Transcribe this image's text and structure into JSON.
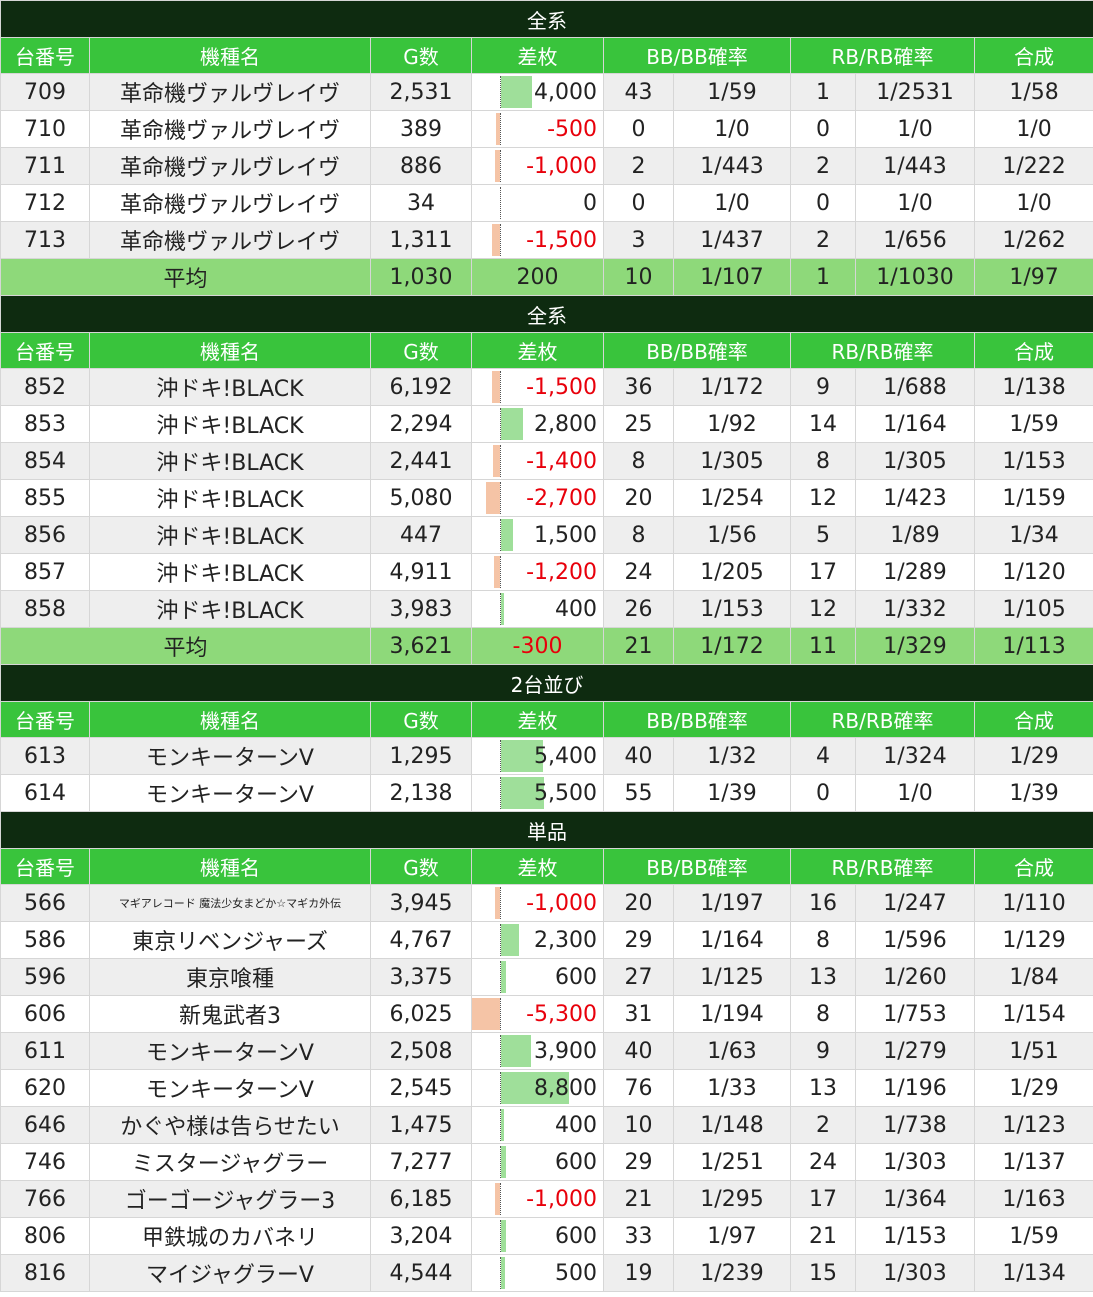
{
  "columns": [
    "台番号",
    "機種名",
    "G数",
    "差枚",
    "BB/BB確率",
    "RB/RB確率",
    "合成"
  ],
  "diff_scale_max": 8800,
  "sections": [
    {
      "title": "全系",
      "rows": [
        {
          "no": "709",
          "name": "革命機ヴァルヴレイヴ",
          "g": "2,531",
          "diff": "4,000",
          "diff_value": 4000,
          "bb": "43",
          "bb_prob": "1/59",
          "rb": "1",
          "rb_prob": "1/2531",
          "total": "1/58"
        },
        {
          "no": "710",
          "name": "革命機ヴァルヴレイヴ",
          "g": "389",
          "diff": "-500",
          "diff_value": -500,
          "bb": "0",
          "bb_prob": "1/0",
          "rb": "0",
          "rb_prob": "1/0",
          "total": "1/0"
        },
        {
          "no": "711",
          "name": "革命機ヴァルヴレイヴ",
          "g": "886",
          "diff": "-1,000",
          "diff_value": -1000,
          "bb": "2",
          "bb_prob": "1/443",
          "rb": "2",
          "rb_prob": "1/443",
          "total": "1/222"
        },
        {
          "no": "712",
          "name": "革命機ヴァルヴレイヴ",
          "g": "34",
          "diff": "0",
          "diff_value": 0,
          "bb": "0",
          "bb_prob": "1/0",
          "rb": "0",
          "rb_prob": "1/0",
          "total": "1/0"
        },
        {
          "no": "713",
          "name": "革命機ヴァルヴレイヴ",
          "g": "1,311",
          "diff": "-1,500",
          "diff_value": -1500,
          "bb": "3",
          "bb_prob": "1/437",
          "rb": "2",
          "rb_prob": "1/656",
          "total": "1/262"
        }
      ],
      "average": {
        "label": "平均",
        "g": "1,030",
        "diff": "200",
        "diff_value": 200,
        "bb": "10",
        "bb_prob": "1/107",
        "rb": "1",
        "rb_prob": "1/1030",
        "total": "1/97"
      }
    },
    {
      "title": "全系",
      "rows": [
        {
          "no": "852",
          "name": "沖ドキ!BLACK",
          "g": "6,192",
          "diff": "-1,500",
          "diff_value": -1500,
          "bb": "36",
          "bb_prob": "1/172",
          "rb": "9",
          "rb_prob": "1/688",
          "total": "1/138"
        },
        {
          "no": "853",
          "name": "沖ドキ!BLACK",
          "g": "2,294",
          "diff": "2,800",
          "diff_value": 2800,
          "bb": "25",
          "bb_prob": "1/92",
          "rb": "14",
          "rb_prob": "1/164",
          "total": "1/59"
        },
        {
          "no": "854",
          "name": "沖ドキ!BLACK",
          "g": "2,441",
          "diff": "-1,400",
          "diff_value": -1400,
          "bb": "8",
          "bb_prob": "1/305",
          "rb": "8",
          "rb_prob": "1/305",
          "total": "1/153"
        },
        {
          "no": "855",
          "name": "沖ドキ!BLACK",
          "g": "5,080",
          "diff": "-2,700",
          "diff_value": -2700,
          "bb": "20",
          "bb_prob": "1/254",
          "rb": "12",
          "rb_prob": "1/423",
          "total": "1/159"
        },
        {
          "no": "856",
          "name": "沖ドキ!BLACK",
          "g": "447",
          "diff": "1,500",
          "diff_value": 1500,
          "bb": "8",
          "bb_prob": "1/56",
          "rb": "5",
          "rb_prob": "1/89",
          "total": "1/34"
        },
        {
          "no": "857",
          "name": "沖ドキ!BLACK",
          "g": "4,911",
          "diff": "-1,200",
          "diff_value": -1200,
          "bb": "24",
          "bb_prob": "1/205",
          "rb": "17",
          "rb_prob": "1/289",
          "total": "1/120"
        },
        {
          "no": "858",
          "name": "沖ドキ!BLACK",
          "g": "3,983",
          "diff": "400",
          "diff_value": 400,
          "bb": "26",
          "bb_prob": "1/153",
          "rb": "12",
          "rb_prob": "1/332",
          "total": "1/105"
        }
      ],
      "average": {
        "label": "平均",
        "g": "3,621",
        "diff": "-300",
        "diff_value": -300,
        "bb": "21",
        "bb_prob": "1/172",
        "rb": "11",
        "rb_prob": "1/329",
        "total": "1/113"
      }
    },
    {
      "title": "2台並び",
      "rows": [
        {
          "no": "613",
          "name": "モンキーターンV",
          "g": "1,295",
          "diff": "5,400",
          "diff_value": 5400,
          "bb": "40",
          "bb_prob": "1/32",
          "rb": "4",
          "rb_prob": "1/324",
          "total": "1/29"
        },
        {
          "no": "614",
          "name": "モンキーターンV",
          "g": "2,138",
          "diff": "5,500",
          "diff_value": 5500,
          "bb": "55",
          "bb_prob": "1/39",
          "rb": "0",
          "rb_prob": "1/0",
          "total": "1/39"
        }
      ]
    },
    {
      "title": "単品",
      "rows": [
        {
          "no": "566",
          "name": "マギアレコード 魔法少女まどか☆マギカ外伝",
          "small": true,
          "g": "3,945",
          "diff": "-1,000",
          "diff_value": -1000,
          "bb": "20",
          "bb_prob": "1/197",
          "rb": "16",
          "rb_prob": "1/247",
          "total": "1/110"
        },
        {
          "no": "586",
          "name": "東京リベンジャーズ",
          "g": "4,767",
          "diff": "2,300",
          "diff_value": 2300,
          "bb": "29",
          "bb_prob": "1/164",
          "rb": "8",
          "rb_prob": "1/596",
          "total": "1/129"
        },
        {
          "no": "596",
          "name": "東京喰種",
          "g": "3,375",
          "diff": "600",
          "diff_value": 600,
          "bb": "27",
          "bb_prob": "1/125",
          "rb": "13",
          "rb_prob": "1/260",
          "total": "1/84"
        },
        {
          "no": "606",
          "name": "新鬼武者3",
          "g": "6,025",
          "diff": "-5,300",
          "diff_value": -5300,
          "bb": "31",
          "bb_prob": "1/194",
          "rb": "8",
          "rb_prob": "1/753",
          "total": "1/154"
        },
        {
          "no": "611",
          "name": "モンキーターンV",
          "g": "2,508",
          "diff": "3,900",
          "diff_value": 3900,
          "bb": "40",
          "bb_prob": "1/63",
          "rb": "9",
          "rb_prob": "1/279",
          "total": "1/51"
        },
        {
          "no": "620",
          "name": "モンキーターンV",
          "g": "2,545",
          "diff": "8,800",
          "diff_value": 8800,
          "bb": "76",
          "bb_prob": "1/33",
          "rb": "13",
          "rb_prob": "1/196",
          "total": "1/29"
        },
        {
          "no": "646",
          "name": "かぐや様は告らせたい",
          "g": "1,475",
          "diff": "400",
          "diff_value": 400,
          "bb": "10",
          "bb_prob": "1/148",
          "rb": "2",
          "rb_prob": "1/738",
          "total": "1/123"
        },
        {
          "no": "746",
          "name": "ミスタージャグラー",
          "g": "7,277",
          "diff": "600",
          "diff_value": 600,
          "bb": "29",
          "bb_prob": "1/251",
          "rb": "24",
          "rb_prob": "1/303",
          "total": "1/137"
        },
        {
          "no": "766",
          "name": "ゴーゴージャグラー3",
          "g": "6,185",
          "diff": "-1,000",
          "diff_value": -1000,
          "bb": "21",
          "bb_prob": "1/295",
          "rb": "17",
          "rb_prob": "1/364",
          "total": "1/163"
        },
        {
          "no": "806",
          "name": "甲鉄城のカバネリ",
          "g": "3,204",
          "diff": "600",
          "diff_value": 600,
          "bb": "33",
          "bb_prob": "1/97",
          "rb": "21",
          "rb_prob": "1/153",
          "total": "1/59"
        },
        {
          "no": "816",
          "name": "マイジャグラーV",
          "g": "4,544",
          "diff": "500",
          "diff_value": 500,
          "bb": "19",
          "bb_prob": "1/239",
          "rb": "15",
          "rb_prob": "1/303",
          "total": "1/134"
        }
      ]
    }
  ]
}
